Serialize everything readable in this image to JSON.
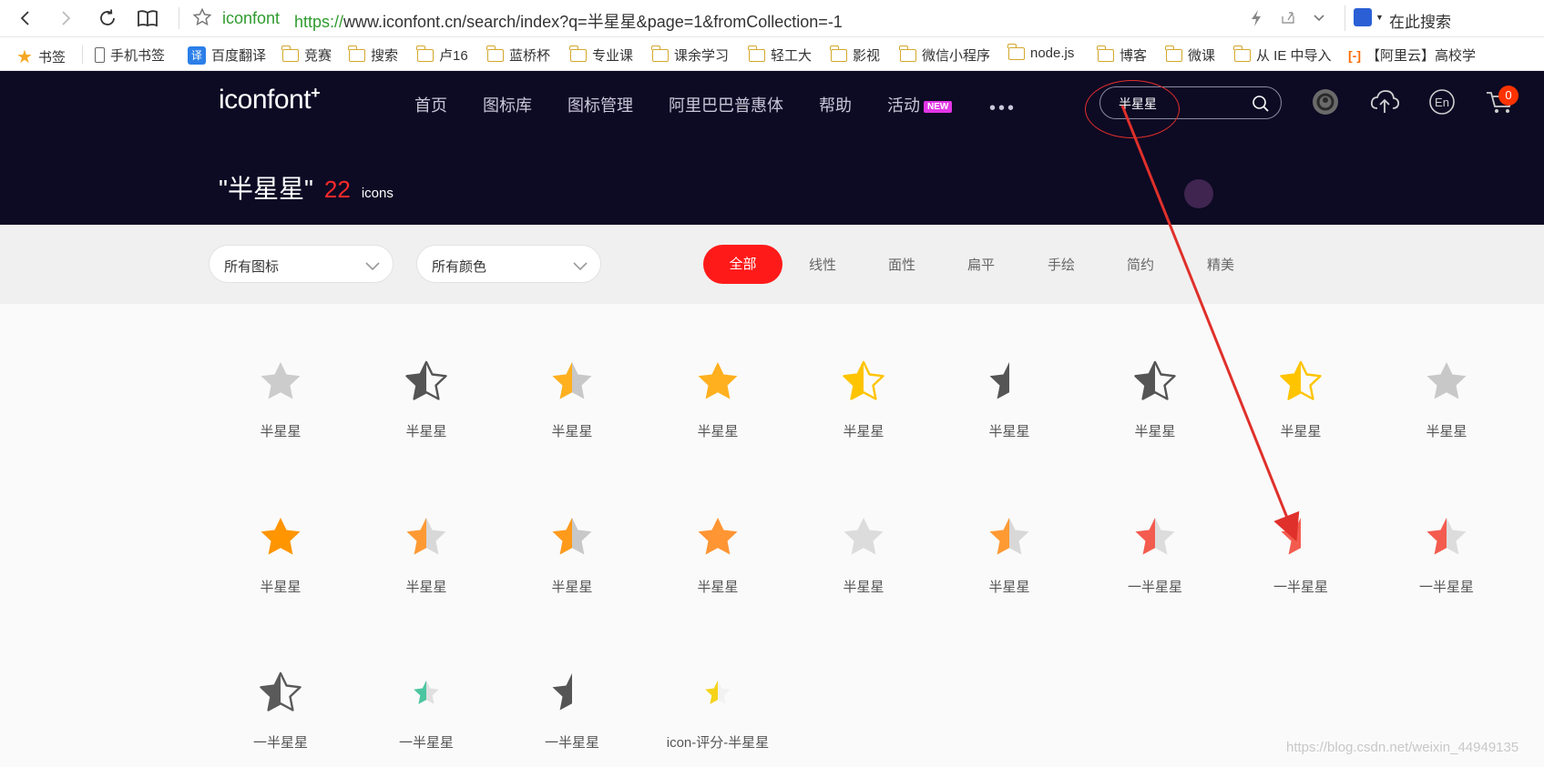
{
  "browser": {
    "site_name": "iconfont",
    "url_scheme": "https://",
    "url_rest": "www.iconfont.cn/search/index?q=半星星&page=1&fromCollection=-1",
    "search_placeholder": "在此搜索"
  },
  "bookmarks": {
    "items": [
      {
        "label": "书签",
        "icon": "bookmark-star-icon"
      },
      {
        "label": "手机书签",
        "icon": "phone-icon"
      },
      {
        "label": "百度翻译",
        "icon": "translate-icon"
      },
      {
        "label": "竞赛",
        "icon": "folder-icon"
      },
      {
        "label": "搜索",
        "icon": "folder-icon"
      },
      {
        "label": "卢16",
        "icon": "folder-icon"
      },
      {
        "label": "蓝桥杯",
        "icon": "folder-icon"
      },
      {
        "label": "专业课",
        "icon": "folder-icon"
      },
      {
        "label": "课余学习",
        "icon": "folder-icon"
      },
      {
        "label": "轻工大",
        "icon": "folder-icon"
      },
      {
        "label": "影视",
        "icon": "folder-icon"
      },
      {
        "label": "微信小程序",
        "icon": "folder-icon"
      },
      {
        "label": "node.js",
        "icon": "folder-icon"
      },
      {
        "label": "博客",
        "icon": "folder-icon"
      },
      {
        "label": "微课",
        "icon": "folder-icon"
      },
      {
        "label": "从 IE 中导入",
        "icon": "folder-icon"
      },
      {
        "label": "【阿里云】高校学",
        "icon": "aliyun-icon"
      }
    ]
  },
  "header": {
    "logo": "iconfont",
    "logo_plus": "+",
    "nav": [
      "首页",
      "图标库",
      "图标管理",
      "阿里巴巴普惠体",
      "帮助",
      "活动"
    ],
    "new_badge": "NEW",
    "more": "•••",
    "search_value": "半星星",
    "cart_count": "0"
  },
  "results": {
    "query": "\"半星星\"",
    "count": "22",
    "unit": "icons"
  },
  "filters": {
    "type_select": "所有图标",
    "color_select": "所有颜色",
    "styles": [
      "全部",
      "线性",
      "面性",
      "扁平",
      "手绘",
      "简约",
      "精美"
    ],
    "active_style": "全部"
  },
  "icons": [
    {
      "label": "半星星",
      "kind": "full",
      "fill": "#cccccc"
    },
    {
      "label": "半星星",
      "kind": "half-outline",
      "fill": "#555555"
    },
    {
      "label": "半星星",
      "kind": "half",
      "fill": "#ffb01f",
      "rest": "#c8c8c8"
    },
    {
      "label": "半星星",
      "kind": "full",
      "fill": "#ffb01f"
    },
    {
      "label": "半星星",
      "kind": "half-outline",
      "fill": "#ffc400"
    },
    {
      "label": "半星星",
      "kind": "left-only",
      "fill": "#555555"
    },
    {
      "label": "半星星",
      "kind": "half-outline",
      "fill": "#555555"
    },
    {
      "label": "半星星",
      "kind": "half-outline",
      "fill": "#ffc400"
    },
    {
      "label": "半星星",
      "kind": "full",
      "fill": "#c8c8c8"
    },
    {
      "label": "半星星",
      "kind": "full",
      "fill": "#ff9500"
    },
    {
      "label": "半星星",
      "kind": "half",
      "fill": "#ff9a33",
      "rest": "#d8d8d8"
    },
    {
      "label": "半星星",
      "kind": "half",
      "fill": "#ff9a1a",
      "rest": "#c8c8c8"
    },
    {
      "label": "半星星",
      "kind": "full",
      "fill": "#ff9533"
    },
    {
      "label": "半星星",
      "kind": "full",
      "fill": "#dcdcdc"
    },
    {
      "label": "半星星",
      "kind": "half",
      "fill": "#ff9a33",
      "rest": "#d8d8d8"
    },
    {
      "label": "一半星星",
      "kind": "half",
      "fill": "#f45b4f",
      "rest": "#dcdcdc"
    },
    {
      "label": "一半星星",
      "kind": "left-only",
      "fill": "#f45b4f"
    },
    {
      "label": "一半星星",
      "kind": "half",
      "fill": "#f45b4f",
      "rest": "#dcdcdc"
    },
    {
      "label": "一半星星",
      "kind": "half-outline",
      "fill": "#5a5a5a"
    },
    {
      "label": "一半星星",
      "kind": "half-small",
      "fill": "#4cc6a0",
      "rest": "#e0e0e0"
    },
    {
      "label": "一半星星",
      "kind": "left-only",
      "fill": "#555555"
    },
    {
      "label": "icon-评分-半星星",
      "kind": "half-small",
      "fill": "#f5d31a",
      "rest": "#f2f2f2"
    }
  ],
  "watermark": "https://blog.csdn.net/weixin_44949135"
}
